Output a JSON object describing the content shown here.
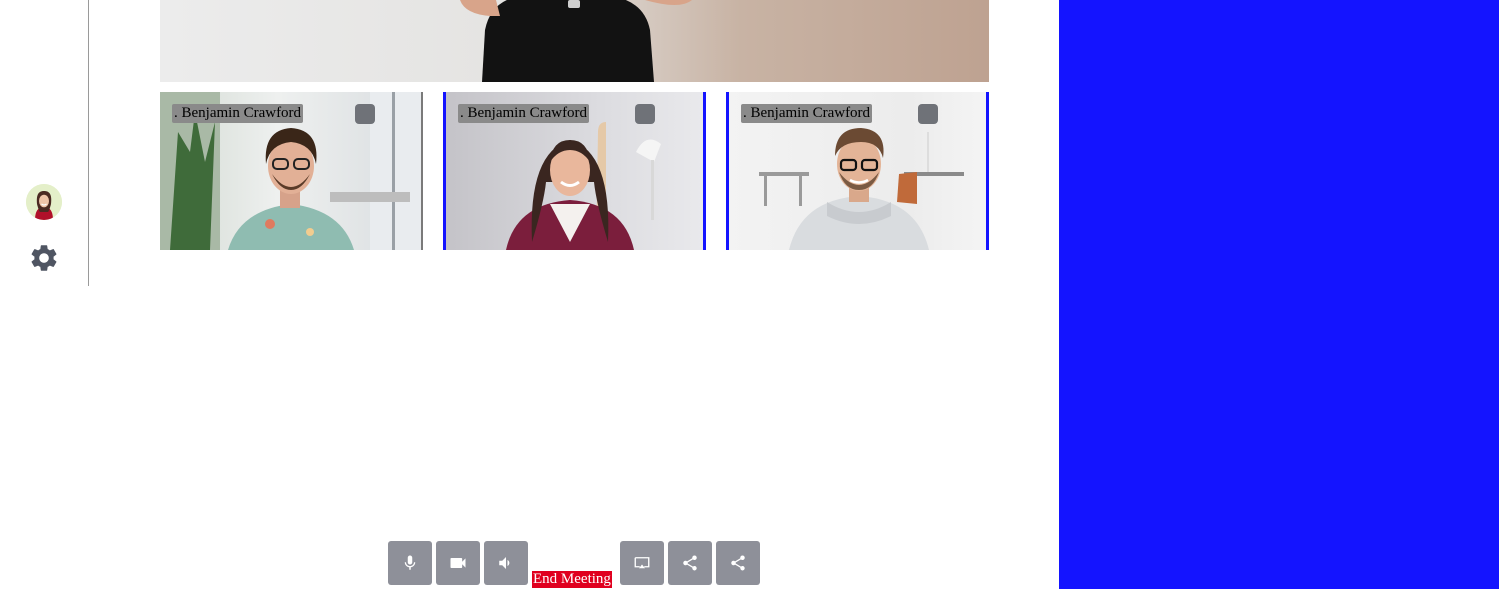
{
  "sidebar": {
    "avatar_icon": "user-avatar",
    "settings_icon": "gear-icon"
  },
  "participants": [
    {
      "name": ". Benjamin Crawford",
      "active_speaker": false
    },
    {
      "name": ". Benjamin Crawford",
      "active_speaker": true
    },
    {
      "name": ". Benjamin Crawford",
      "active_speaker": true
    }
  ],
  "controls": {
    "buttons": [
      "microphone-icon",
      "camera-icon",
      "speaker-icon"
    ],
    "end_meeting_label": "End Meeting",
    "right_buttons": [
      "screen-cast-icon",
      "share-icon",
      "share-icon"
    ]
  },
  "colors": {
    "right_panel": "#1414ff",
    "end_meeting": "#e0001f",
    "control_button": "#8e9099",
    "active_tile_border": "#1414ff"
  }
}
